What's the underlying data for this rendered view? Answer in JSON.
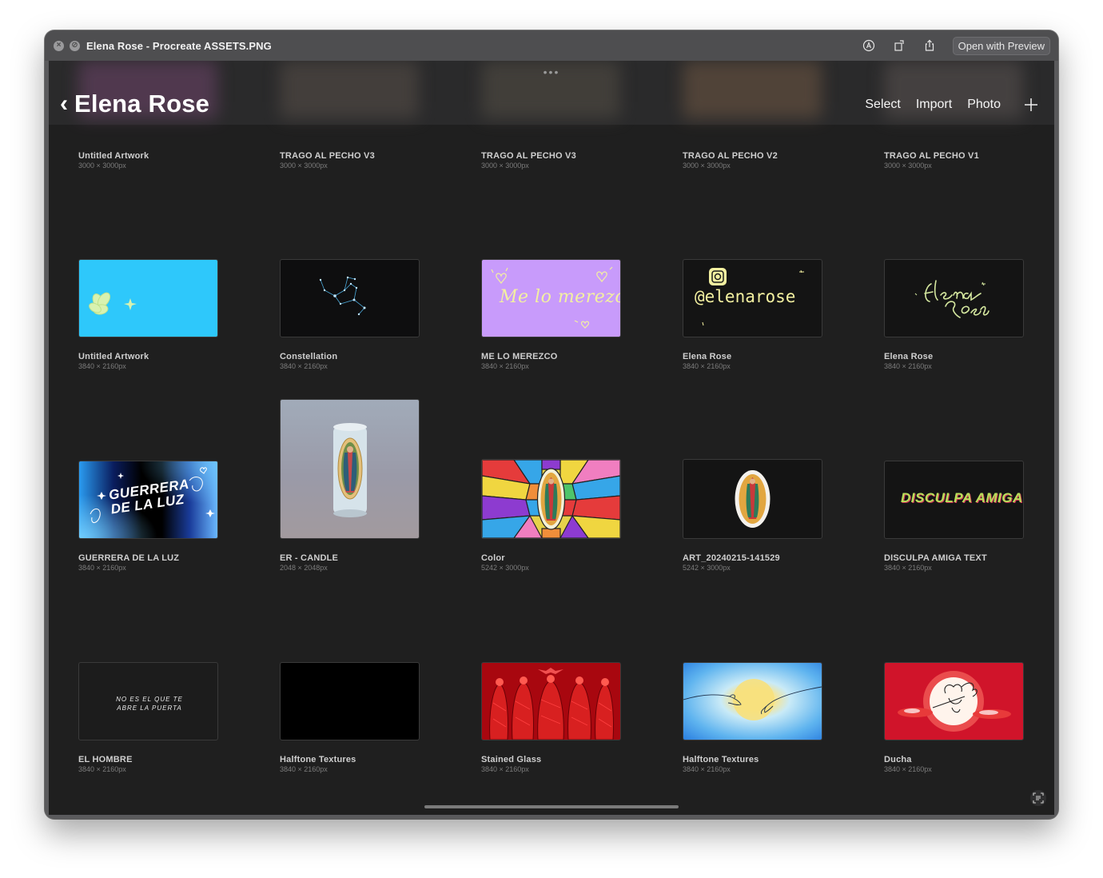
{
  "window": {
    "title": "Elena Rose - Procreate ASSETS.PNG",
    "open_with": "Open with Preview",
    "icons": [
      "close-icon",
      "stop-icon",
      "markup-icon",
      "rotate-icon",
      "share-icon"
    ]
  },
  "header": {
    "back_title": "Elena Rose",
    "actions": [
      "Select",
      "Import",
      "Photo"
    ],
    "grabber": "•••"
  },
  "top_row": [
    {
      "name": "Untitled Artwork",
      "dims": "3000 × 3000px"
    },
    {
      "name": "TRAGO AL PECHO V3",
      "dims": "3000 × 3000px"
    },
    {
      "name": "TRAGO AL PECHO V3",
      "dims": "3000 × 3000px"
    },
    {
      "name": "TRAGO AL PECHO V2",
      "dims": "3000 × 3000px"
    },
    {
      "name": "TRAGO AL PECHO V1",
      "dims": "3000 × 3000px"
    }
  ],
  "rows": [
    [
      {
        "name": "Untitled Artwork",
        "dims": "3840 × 2160px",
        "thumb_text": ""
      },
      {
        "name": "Constellation",
        "dims": "3840 × 2160px",
        "thumb_text": ""
      },
      {
        "name": "ME LO MEREZCO",
        "dims": "3840 × 2160px",
        "thumb_text": "Me lo merezco"
      },
      {
        "name": "Elena Rose",
        "dims": "3840 × 2160px",
        "thumb_text": "@elenarose"
      },
      {
        "name": "Elena Rose",
        "dims": "3840 × 2160px",
        "thumb_text": "Elena Rose"
      }
    ],
    [
      {
        "name": "GUERRERA DE LA LUZ",
        "dims": "3840 × 2160px",
        "thumb_text": "GUERRERA DE LA LUZ"
      },
      {
        "name": "ER - CANDLE",
        "dims": "2048 × 2048px",
        "thumb_text": ""
      },
      {
        "name": "Color",
        "dims": "5242 × 3000px",
        "thumb_text": ""
      },
      {
        "name": "ART_20240215-141529",
        "dims": "5242 × 3000px",
        "thumb_text": ""
      },
      {
        "name": "DISCULPA AMIGA TEXT",
        "dims": "3840 × 2160px",
        "thumb_text": "DISCULPA AMIGA"
      }
    ],
    [
      {
        "name": "EL HOMBRE",
        "dims": "3840 × 2160px",
        "thumb_text": "NO ES EL QUE TE ABRE LA PUERTA"
      },
      {
        "name": "Halftone Textures",
        "dims": "3840 × 2160px",
        "thumb_text": ""
      },
      {
        "name": "Stained Glass",
        "dims": "3840 × 2160px",
        "thumb_text": ""
      },
      {
        "name": "Halftone Textures",
        "dims": "3840 × 2160px",
        "thumb_text": ""
      },
      {
        "name": "Ducha",
        "dims": "3840 × 2160px",
        "thumb_text": ""
      }
    ]
  ],
  "colors": {
    "screen_bg": "#1f1f1f",
    "titlebar_bg": "#4e4e50",
    "accent_cyan": "#2ec8fb",
    "accent_purple": "#c89bfb",
    "accent_yellow": "#f3f0a0",
    "accent_red": "#c0111a"
  }
}
